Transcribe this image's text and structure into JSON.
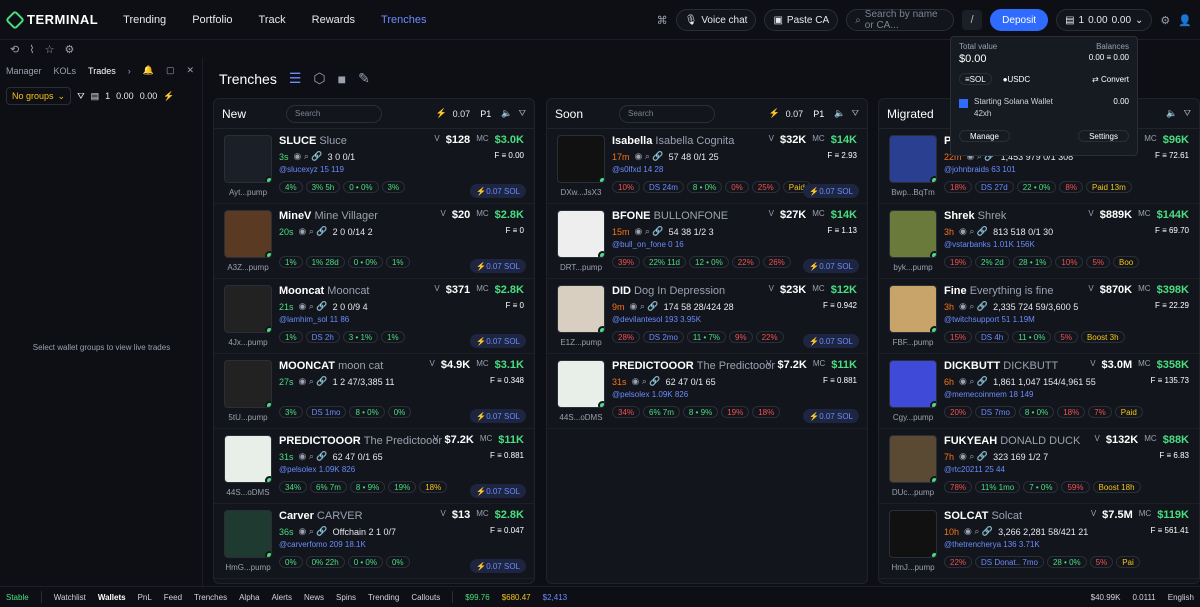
{
  "app": {
    "name": "TERMINAL"
  },
  "nav": [
    "Trending",
    "Portfolio",
    "Track",
    "Rewards",
    "Trenches"
  ],
  "top": {
    "voice": "Voice chat",
    "paste": "Paste CA",
    "search": "Search by name or CA...",
    "kbd": "/",
    "deposit": "Deposit",
    "wallet_count": "1",
    "bal1": "0.00",
    "bal2": "0.00"
  },
  "popup": {
    "total_label": "Total value",
    "balances_label": "Balances",
    "total": "$0.00",
    "bal_a": "0.00",
    "bal_b": "0.00",
    "sol": "SOL",
    "usdc": "USDC",
    "convert": "Convert",
    "wallet": "Starting Solana Wallet",
    "wallet_sub": "42xh",
    "wallet_bal": "0.00",
    "manage": "Manage",
    "settings": "Settings"
  },
  "left": {
    "tabs": [
      "Manager",
      "KOLs",
      "Trades"
    ],
    "groups": "No groups",
    "count": "1",
    "v1": "0.00",
    "v2": "0.00",
    "empty": "Select wallet groups to view live trades"
  },
  "title": "Trenches",
  "cols": [
    {
      "name": "New",
      "search": "Search",
      "amt": "0.07",
      "p": "P1",
      "cards": [
        {
          "sym": "SLUCE",
          "name": "Sluce",
          "ca": "Ayt...pump",
          "age": "3s",
          "stats": "3  0  0/1",
          "soc": "@slucexyz  15  119",
          "b": [
            "4%",
            "3%  5h",
            "0 • 0%",
            "3%"
          ],
          "v": "$128",
          "mc": "$3.0K",
          "f": "0.00",
          "sol": "0.07 SOL",
          "ac": "#1b1f28"
        },
        {
          "sym": "MineV",
          "name": "Mine Villager",
          "ca": "A3Z...pump",
          "age": "20s",
          "stats": "2  0  0/14  2",
          "soc": "",
          "b": [
            "1%",
            "1%  28d",
            "0 • 0%",
            "1%"
          ],
          "v": "$20",
          "mc": "$2.8K",
          "f": "0",
          "sol": "0.07 SOL",
          "ac": "#5b3a24"
        },
        {
          "sym": "Mooncat",
          "name": "Mooncat",
          "ca": "4Jx...pump",
          "age": "21s",
          "stats": "2  0  0/9  4",
          "soc": "@lamhim_sol  11  86",
          "b": [
            "1%",
            "DS  2h",
            "3 • 1%",
            "1%"
          ],
          "v": "$371",
          "mc": "$2.8K",
          "f": "0",
          "sol": "0.07 SOL",
          "ac": "#222"
        },
        {
          "sym": "MOONCAT",
          "name": "moon cat",
          "ca": "5tU...pump",
          "age": "27s",
          "stats": "1  2  47/3,385  11",
          "soc": "",
          "b": [
            "3%",
            "DS  1mo",
            "8 • 0%",
            "0%"
          ],
          "v": "$4.9K",
          "mc": "$3.1K",
          "f": "0.348",
          "sol": "0.07 SOL",
          "ac": "#222"
        },
        {
          "sym": "PREDICTOOOR",
          "name": "The Predictooor",
          "ca": "44S...oDMS",
          "age": "31s",
          "stats": "62  47  0/1  65",
          "soc": "@pelsolex  1.09K  826",
          "b": [
            "34%",
            "6%  7m",
            "8 • 9%",
            "19%",
            "18%"
          ],
          "v": "$7.2K",
          "mc": "$11K",
          "f": "0.881",
          "sol": "0.07 SOL",
          "ac": "#e8efe8"
        },
        {
          "sym": "Carver",
          "name": "CARVER",
          "ca": "HmG...pump",
          "age": "36s",
          "stats": "Offchain  2  1  0/7",
          "soc": "@carverfomo  209  18.1K",
          "b": [
            "0%",
            "0%  22h",
            "0 • 0%",
            "0%"
          ],
          "v": "$13",
          "mc": "$2.8K",
          "f": "0.047",
          "sol": "0.07 SOL",
          "ac": "#1f3a30"
        }
      ]
    },
    {
      "name": "Soon",
      "search": "Search",
      "amt": "0.07",
      "p": "P1",
      "cards": [
        {
          "sym": "Isabella",
          "name": "Isabella Cognita",
          "ca": "DXw...JsX3",
          "age": "17m",
          "stats": "57  48  0/1  25",
          "soc": "@s0lfxd  14  28",
          "b": [
            "10%",
            "DS  24m",
            "8 • 0%",
            "0%",
            "25%",
            "Paid"
          ],
          "v": "$32K",
          "mc": "$14K",
          "f": "2.93",
          "sol": "0.07 SOL",
          "ac": "#111"
        },
        {
          "sym": "BFONE",
          "name": "BULLONFONE",
          "ca": "DRT...pump",
          "age": "15m",
          "stats": "54  38  1/2  3",
          "soc": "@bull_on_fone  0  16",
          "b": [
            "39%",
            "22%  11d",
            "12 • 0%",
            "22%",
            "26%"
          ],
          "v": "$27K",
          "mc": "$14K",
          "f": "1.13",
          "sol": "0.07 SOL",
          "ac": "#eee"
        },
        {
          "sym": "DID",
          "name": "Dog In Depression",
          "ca": "E1Z...pump",
          "age": "9m",
          "stats": "174  58  28/424  28",
          "soc": "@devilantesol  193  3.95K",
          "b": [
            "28%",
            "DS  2mo",
            "11 • 7%",
            "9%",
            "22%"
          ],
          "v": "$23K",
          "mc": "$12K",
          "f": "0.942",
          "sol": "0.07 SOL",
          "ac": "#d9cfc0"
        },
        {
          "sym": "PREDICTOOOR",
          "name": "The Predictooor",
          "ca": "44S...oDMS",
          "age": "31s",
          "stats": "62  47  0/1  65",
          "soc": "@pelsolex  1.09K  826",
          "b": [
            "34%",
            "6%  7m",
            "8 • 9%",
            "19%",
            "18%"
          ],
          "v": "$7.2K",
          "mc": "$11K",
          "f": "0.881",
          "sol": "0.07 SOL",
          "ac": "#e8efe8"
        }
      ]
    },
    {
      "name": "Migrated",
      "search": "",
      "amt": "",
      "p": "",
      "cards": [
        {
          "sym": "Pi",
          "name": "",
          "ca": "Bwp...BqTm",
          "age": "22m",
          "stats": "1,453  979  0/1  308",
          "soc": "@johnbraids  63  101",
          "b": [
            "18%",
            "DS  27d",
            "22 • 0%",
            "8%",
            "Paid 13m"
          ],
          "v": "$96K",
          "mc": "$96K",
          "f": "72.61",
          "sol": "",
          "ac": "#2a3f8f"
        },
        {
          "sym": "Shrek",
          "name": "Shrek",
          "ca": "byk...pump",
          "age": "3h",
          "stats": "813  518  0/1  30",
          "soc": "@vstarbanks  1.01K  156K",
          "b": [
            "19%",
            "2%  2d",
            "28 • 1%",
            "10%",
            "5%",
            "Boo"
          ],
          "v": "$889K",
          "mc": "$144K",
          "f": "69.70",
          "sol": "",
          "ac": "#6a7a3a"
        },
        {
          "sym": "Fine",
          "name": "Everything is fine",
          "ca": "FBF...pump",
          "age": "3h",
          "stats": "2,335  724  59/3,600  5",
          "soc": "@twitchsupport  51  1.19M",
          "b": [
            "15%",
            "DS  4h",
            "11 • 0%",
            "5%",
            "Boost 3h"
          ],
          "v": "$870K",
          "mc": "$398K",
          "f": "22.29",
          "sol": "",
          "ac": "#c9a46a"
        },
        {
          "sym": "DICKBUTT",
          "name": "DICKBUTT",
          "ca": "Cgy...pump",
          "age": "6h",
          "stats": "1,861  1,047  154/4,961  55",
          "soc": "@memecoinmem  18  149",
          "b": [
            "20%",
            "DS  7mo",
            "8 • 0%",
            "18%",
            "7%",
            "Paid"
          ],
          "v": "$3.0M",
          "mc": "$358K",
          "f": "135.73",
          "sol": "",
          "ac": "#3f4bd8"
        },
        {
          "sym": "FUKYEAH",
          "name": "DONALD DUCK",
          "ca": "DUc...pump",
          "age": "7h",
          "stats": "323  169  1/2  7",
          "soc": "@rtc20211  25  44",
          "b": [
            "78%",
            "11%  1mo",
            "7 • 0%",
            "59%",
            "Boost 18h"
          ],
          "v": "$132K",
          "mc": "$88K",
          "f": "6.83",
          "sol": "",
          "ac": "#5a4a33"
        },
        {
          "sym": "SOLCAT",
          "name": "Solcat",
          "ca": "HmJ...pump",
          "age": "10h",
          "stats": "3,266  2,281  58/421  21",
          "soc": "@thetrencherya  136  3.71K",
          "b": [
            "22%",
            "DS  Donat..  7mo",
            "28 • 0%",
            "5%",
            "Pai"
          ],
          "v": "$7.5M",
          "mc": "$119K",
          "f": "561.41",
          "sol": "",
          "ac": "#111"
        }
      ]
    }
  ],
  "bottom": {
    "stable": "Stable",
    "items": [
      "Watchlist",
      "Wallets",
      "PnL",
      "Feed",
      "Trenches",
      "Alpha",
      "Alerts",
      "News",
      "Spins",
      "Trending",
      "Callouts"
    ],
    "p1": "$99.76",
    "p2": "$680.47",
    "p3": "$2,413",
    "mc": "$40.99K",
    "x": "0.0111",
    "lang": "English"
  }
}
